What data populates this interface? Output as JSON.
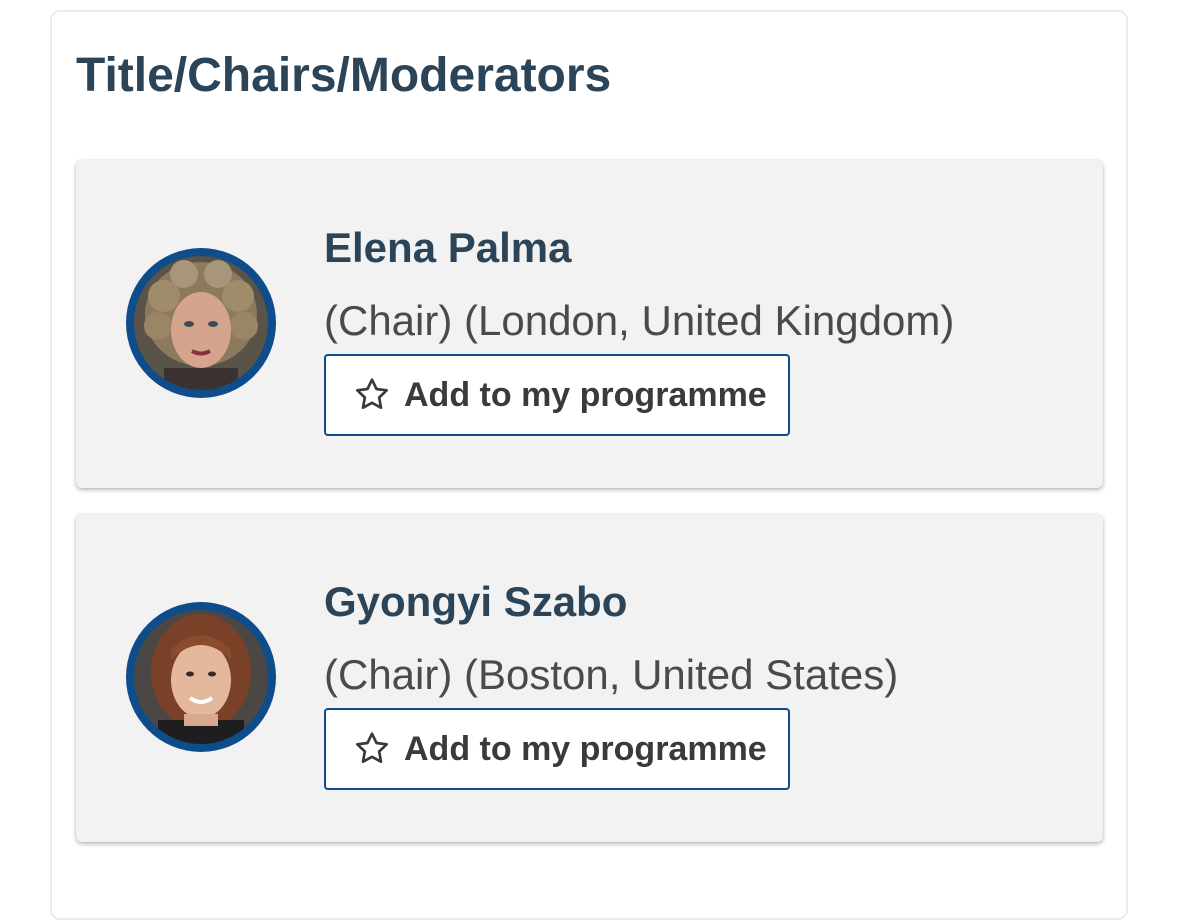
{
  "section": {
    "title": "Title/Chairs/Moderators"
  },
  "people": [
    {
      "name": "Elena Palma",
      "meta": "(Chair) (London, United Kingdom)",
      "add_label": "Add to my programme",
      "icon": "star-outline-icon"
    },
    {
      "name": "Gyongyi Szabo",
      "meta": "(Chair) (Boston, United States)",
      "add_label": "Add to my programme",
      "icon": "star-outline-icon"
    }
  ],
  "colors": {
    "heading": "#2c4458",
    "accent_border": "#0f4c8a",
    "card_bg": "#f2f2f2",
    "meta_text": "#4a4a4a"
  }
}
